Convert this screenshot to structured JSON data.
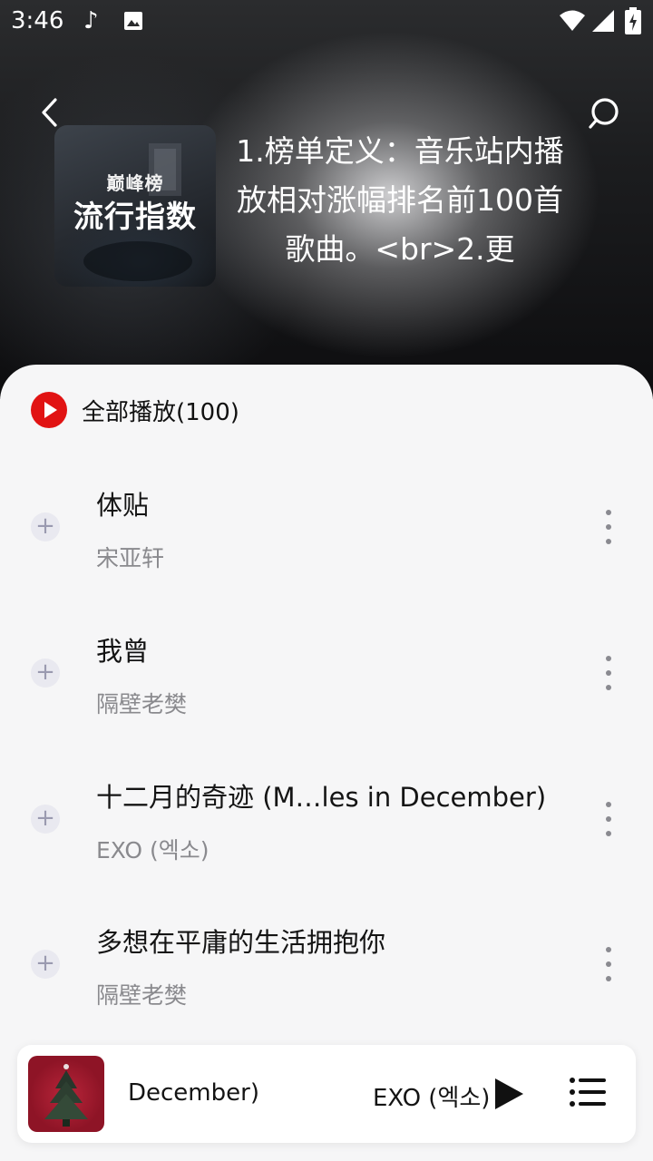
{
  "status_bar": {
    "time": "3:46",
    "icons": [
      "music-note-icon",
      "image-icon",
      "wifi-icon",
      "signal-icon",
      "battery-charging-icon"
    ]
  },
  "header": {
    "back_icon": "back-arrow-icon",
    "search_icon": "search-icon",
    "cover": {
      "logo_text": "巅峰榜",
      "title": "流行指数"
    },
    "description": "1.榜单定义：音乐站内播放相对涨幅排名前100首歌曲。<br>2.更"
  },
  "list": {
    "play_all_label": "全部播放(100)",
    "songs": [
      {
        "title": "体贴",
        "artist": "宋亚轩"
      },
      {
        "title": "我曾",
        "artist": "隔壁老樊"
      },
      {
        "title": "十二月的奇迹 (M…les in December)",
        "artist": "EXO (엑소)"
      },
      {
        "title": "多想在平庸的生活拥抱你",
        "artist": "隔壁老樊"
      }
    ]
  },
  "mini_player": {
    "song_fragment": "December)",
    "artist_fragment": "EXO (엑소)",
    "play_icon": "play-icon",
    "queue_icon": "playlist-icon"
  },
  "colors": {
    "accent_red": "#e11313",
    "sheet_bg": "#f6f6f7",
    "secondary_text": "#8a8a8e"
  }
}
